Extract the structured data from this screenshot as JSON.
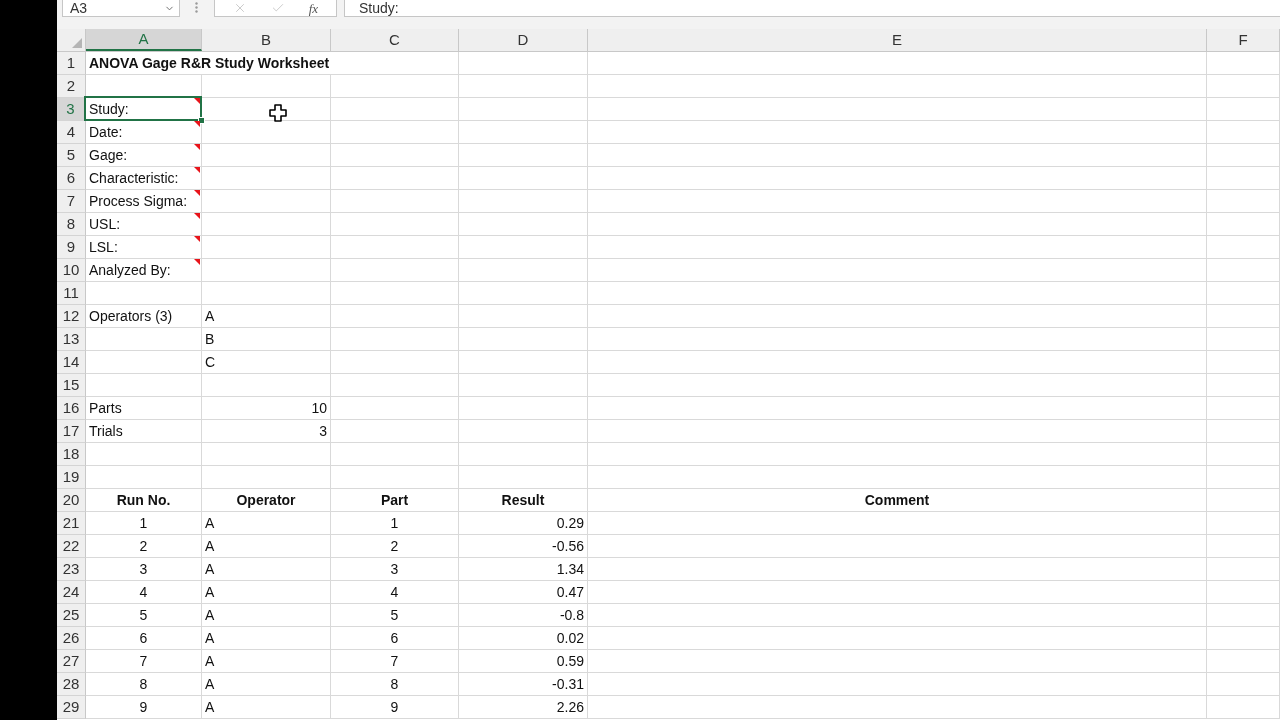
{
  "formula_bar": {
    "name_box": "A3",
    "buttons": [
      {
        "kind": "cancel",
        "disabled": true
      },
      {
        "kind": "enter",
        "disabled": true
      }
    ],
    "function_button": "fx",
    "formula": "Study:"
  },
  "columns": [
    {
      "label": "A",
      "selected": true
    },
    {
      "label": "B",
      "selected": false
    },
    {
      "label": "C",
      "selected": false
    },
    {
      "label": "D",
      "selected": false
    },
    {
      "label": "E",
      "selected": false
    },
    {
      "label": "F",
      "selected": false
    }
  ],
  "rows": [
    {
      "number": "1",
      "selected": false,
      "title": "ANOVA Gage R&R Study Worksheet"
    },
    {
      "number": "2",
      "selected": false
    },
    {
      "number": "3",
      "selected": true,
      "cells": {
        "a": {
          "text": "Study:",
          "kind": "label",
          "comment": true,
          "selected": true
        }
      }
    },
    {
      "number": "4",
      "selected": false,
      "cells": {
        "a": {
          "text": "Date:",
          "kind": "label",
          "comment": true,
          "selected": false
        }
      }
    },
    {
      "number": "5",
      "selected": false,
      "cells": {
        "a": {
          "text": "Gage:",
          "kind": "label",
          "comment": true,
          "selected": false
        }
      }
    },
    {
      "number": "6",
      "selected": false,
      "cells": {
        "a": {
          "text": "Characteristic:",
          "kind": "label",
          "comment": true,
          "selected": false
        }
      }
    },
    {
      "number": "7",
      "selected": false,
      "cells": {
        "a": {
          "text": "Process Sigma:",
          "kind": "label",
          "comment": true,
          "selected": false
        }
      }
    },
    {
      "number": "8",
      "selected": false,
      "cells": {
        "a": {
          "text": "USL:",
          "kind": "label",
          "comment": true,
          "selected": false
        }
      }
    },
    {
      "number": "9",
      "selected": false,
      "cells": {
        "a": {
          "text": "LSL:",
          "kind": "label",
          "comment": true,
          "selected": false
        }
      }
    },
    {
      "number": "10",
      "selected": false,
      "cells": {
        "a": {
          "text": "Analyzed By:",
          "kind": "label",
          "comment": true,
          "selected": false
        }
      }
    },
    {
      "number": "11",
      "selected": false
    },
    {
      "number": "12",
      "selected": false,
      "cells": {
        "a": {
          "text": "Operators (3)",
          "kind": "label",
          "comment": false,
          "selected": false
        },
        "b": {
          "text": "A",
          "kind": "label",
          "comment": false,
          "selected": false
        }
      }
    },
    {
      "number": "13",
      "selected": false,
      "cells": {
        "b": {
          "text": "B",
          "kind": "label",
          "comment": false,
          "selected": false
        }
      }
    },
    {
      "number": "14",
      "selected": false,
      "cells": {
        "b": {
          "text": "C",
          "kind": "label",
          "comment": false,
          "selected": false
        }
      }
    },
    {
      "number": "15",
      "selected": false
    },
    {
      "number": "16",
      "selected": false,
      "cells": {
        "a": {
          "text": "Parts",
          "kind": "label",
          "comment": false,
          "selected": false
        },
        "b": {
          "text": "10",
          "kind": "number",
          "comment": false,
          "selected": false
        }
      }
    },
    {
      "number": "17",
      "selected": false,
      "cells": {
        "a": {
          "text": "Trials",
          "kind": "label",
          "comment": false,
          "selected": false
        },
        "b": {
          "text": "3",
          "kind": "number",
          "comment": false,
          "selected": false
        }
      }
    },
    {
      "number": "18",
      "selected": false
    },
    {
      "number": "19",
      "selected": false
    },
    {
      "number": "20",
      "selected": false,
      "cells": {
        "a": {
          "text": "Run No.",
          "kind": "heading",
          "comment": false,
          "selected": false
        },
        "b": {
          "text": "Operator",
          "kind": "heading",
          "comment": false,
          "selected": false
        },
        "c": {
          "text": "Part",
          "kind": "heading",
          "comment": false,
          "selected": false
        },
        "d": {
          "text": "Result",
          "kind": "heading",
          "comment": false,
          "selected": false
        },
        "e": {
          "text": "Comment",
          "kind": "heading",
          "comment": false,
          "selected": false
        }
      }
    },
    {
      "number": "21",
      "selected": false,
      "cells": {
        "a": {
          "text": "1",
          "kind": "index",
          "comment": false,
          "selected": false
        },
        "b": {
          "text": "A",
          "kind": "label",
          "comment": false,
          "selected": false
        },
        "c": {
          "text": "1",
          "kind": "index",
          "comment": false,
          "selected": false
        },
        "d": {
          "text": "0.29",
          "kind": "number",
          "comment": false,
          "selected": false
        }
      }
    },
    {
      "number": "22",
      "selected": false,
      "cells": {
        "a": {
          "text": "2",
          "kind": "index",
          "comment": false,
          "selected": false
        },
        "b": {
          "text": "A",
          "kind": "label",
          "comment": false,
          "selected": false
        },
        "c": {
          "text": "2",
          "kind": "index",
          "comment": false,
          "selected": false
        },
        "d": {
          "text": "-0.56",
          "kind": "number",
          "comment": false,
          "selected": false
        }
      }
    },
    {
      "number": "23",
      "selected": false,
      "cells": {
        "a": {
          "text": "3",
          "kind": "index",
          "comment": false,
          "selected": false
        },
        "b": {
          "text": "A",
          "kind": "label",
          "comment": false,
          "selected": false
        },
        "c": {
          "text": "3",
          "kind": "index",
          "comment": false,
          "selected": false
        },
        "d": {
          "text": "1.34",
          "kind": "number",
          "comment": false,
          "selected": false
        }
      }
    },
    {
      "number": "24",
      "selected": false,
      "cells": {
        "a": {
          "text": "4",
          "kind": "index",
          "comment": false,
          "selected": false
        },
        "b": {
          "text": "A",
          "kind": "label",
          "comment": false,
          "selected": false
        },
        "c": {
          "text": "4",
          "kind": "index",
          "comment": false,
          "selected": false
        },
        "d": {
          "text": "0.47",
          "kind": "number",
          "comment": false,
          "selected": false
        }
      }
    },
    {
      "number": "25",
      "selected": false,
      "cells": {
        "a": {
          "text": "5",
          "kind": "index",
          "comment": false,
          "selected": false
        },
        "b": {
          "text": "A",
          "kind": "label",
          "comment": false,
          "selected": false
        },
        "c": {
          "text": "5",
          "kind": "index",
          "comment": false,
          "selected": false
        },
        "d": {
          "text": "-0.8",
          "kind": "number",
          "comment": false,
          "selected": false
        }
      }
    },
    {
      "number": "26",
      "selected": false,
      "cells": {
        "a": {
          "text": "6",
          "kind": "index",
          "comment": false,
          "selected": false
        },
        "b": {
          "text": "A",
          "kind": "label",
          "comment": false,
          "selected": false
        },
        "c": {
          "text": "6",
          "kind": "index",
          "comment": false,
          "selected": false
        },
        "d": {
          "text": "0.02",
          "kind": "number",
          "comment": false,
          "selected": false
        }
      }
    },
    {
      "number": "27",
      "selected": false,
      "cells": {
        "a": {
          "text": "7",
          "kind": "index",
          "comment": false,
          "selected": false
        },
        "b": {
          "text": "A",
          "kind": "label",
          "comment": false,
          "selected": false
        },
        "c": {
          "text": "7",
          "kind": "index",
          "comment": false,
          "selected": false
        },
        "d": {
          "text": "0.59",
          "kind": "number",
          "comment": false,
          "selected": false
        }
      }
    },
    {
      "number": "28",
      "selected": false,
      "cells": {
        "a": {
          "text": "8",
          "kind": "index",
          "comment": false,
          "selected": false
        },
        "b": {
          "text": "A",
          "kind": "label",
          "comment": false,
          "selected": false
        },
        "c": {
          "text": "8",
          "kind": "index",
          "comment": false,
          "selected": false
        },
        "d": {
          "text": "-0.31",
          "kind": "number",
          "comment": false,
          "selected": false
        }
      }
    },
    {
      "number": "29",
      "selected": false,
      "cells": {
        "a": {
          "text": "9",
          "kind": "index",
          "comment": false,
          "selected": false
        },
        "b": {
          "text": "A",
          "kind": "label",
          "comment": false,
          "selected": false
        },
        "c": {
          "text": "9",
          "kind": "index",
          "comment": false,
          "selected": false
        },
        "d": {
          "text": "2.26",
          "kind": "number",
          "comment": false,
          "selected": false
        }
      }
    }
  ]
}
